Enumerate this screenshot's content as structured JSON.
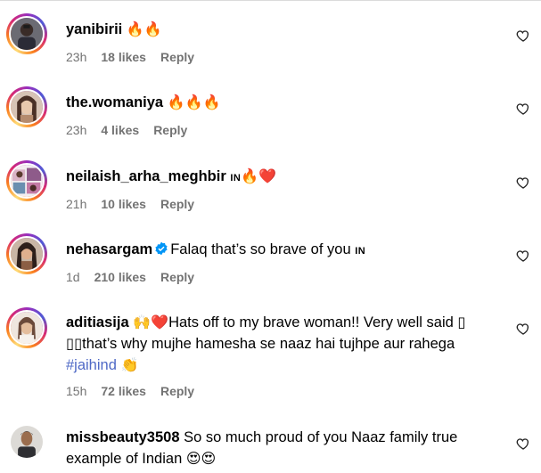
{
  "comments": [
    {
      "username": "yanibirii",
      "text": "",
      "emoji": "🔥🔥",
      "time": "23h",
      "likes": "18 likes",
      "reply": "Reply"
    },
    {
      "username": "the.womaniya",
      "text": "",
      "emoji": "🔥🔥🔥",
      "time": "23h",
      "likes": "4 likes",
      "reply": "Reply"
    },
    {
      "username": "neilaish_arha_meghbir",
      "text": "IN",
      "emoji": "🔥❤️",
      "time": "21h",
      "likes": "10 likes",
      "reply": "Reply"
    },
    {
      "username": "nehasargam",
      "text": "Falaq that’s so brave of you",
      "flag": "IN",
      "time": "1d",
      "likes": "210 likes",
      "reply": "Reply"
    },
    {
      "username": "aditiasija",
      "emoji": "🙌❤️",
      "text": "Hats off to my brave woman!! Very well said ",
      "text2": "that’s why mujhe hamesha se naaz hai tujhpe aur rahega",
      "hashtag": "#jaihind",
      "emoji2": "👏",
      "time": "15h",
      "likes": "72 likes",
      "reply": "Reply"
    },
    {
      "username": "missbeauty3508",
      "text": "So so much proud of you Naaz family true",
      "text2": "example of Indian",
      "emoji2": "😍😍"
    }
  ]
}
